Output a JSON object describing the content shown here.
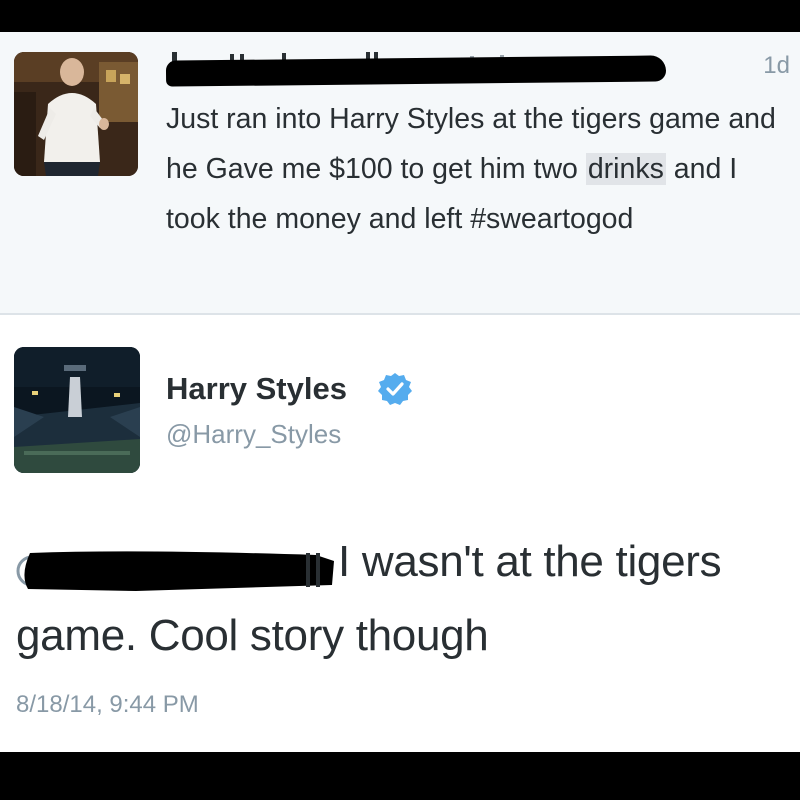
{
  "tweet_top": {
    "time_ago": "1d",
    "text": "Just ran into Harry Styles at the tigers game and he Gave me $100 to get him two",
    "blurred_word": "drinks",
    "text_end": "and I took the money and left #sweartogod",
    "author_redacted": true
  },
  "tweet_main": {
    "display_name": "Harry Styles",
    "handle": "@Harry_Styles",
    "verified_icon": "verified-badge-icon",
    "reply_line1": "I wasn't at the tigers",
    "reply_line2": "game. Cool story though",
    "timestamp": "8/18/14, 9:44 PM"
  },
  "colors": {
    "verified_blue": "#55acee",
    "text": "#292f33",
    "muted": "#8899a6",
    "top_background": "#f5f8fa"
  }
}
